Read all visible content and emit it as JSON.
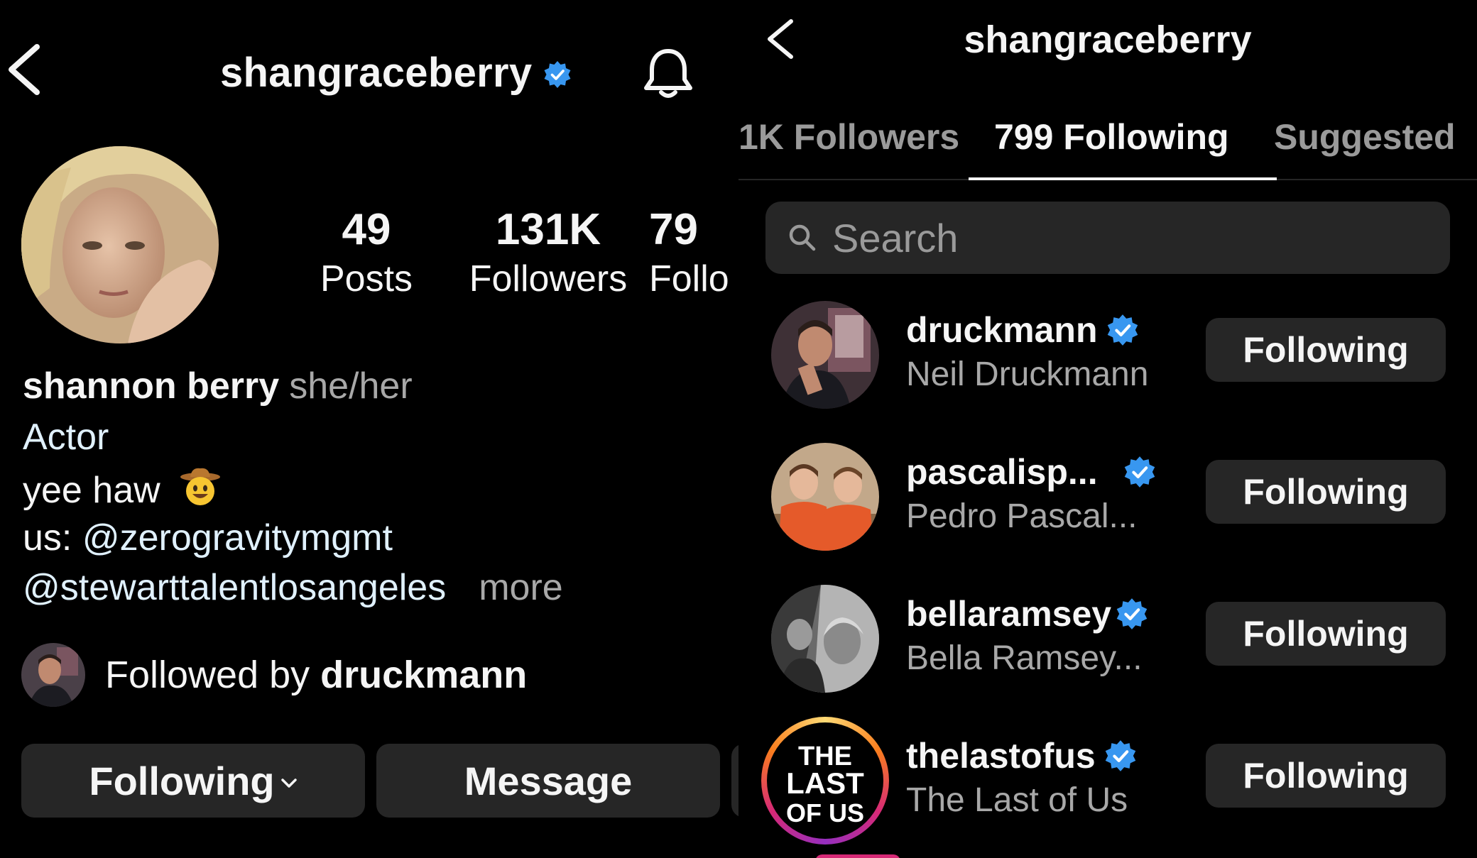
{
  "profile": {
    "username": "shangraceberry",
    "stats": {
      "posts": {
        "value": "49",
        "label": "Posts"
      },
      "followers": {
        "value": "131K",
        "label": "Followers"
      },
      "following": {
        "value": "79",
        "label": "Follo"
      }
    },
    "name": "shannon berry",
    "pronouns": "she/her",
    "category": "Actor",
    "bio_line": "yee haw",
    "bio_mgmt_prefix": "us: ",
    "bio_mgmt_handle": "@zerogravitymgmt",
    "bio_agency_handle": "@stewarttalentlosangeles",
    "bio_more": "more",
    "followed_by_prefix": "Followed by ",
    "followed_by_user": "druckmann",
    "buttons": {
      "following": "Following",
      "message": "Message"
    }
  },
  "following_page": {
    "title": "shangraceberry",
    "tabs": [
      {
        "label": "1K Followers"
      },
      {
        "label": "799 Following"
      },
      {
        "label": "Suggested"
      }
    ],
    "search": {
      "placeholder": "Search"
    },
    "rows": [
      {
        "username": "druckmann",
        "display_name": "Neil Druckmann",
        "button": "Following"
      },
      {
        "username": "pascalisp...",
        "display_name": "Pedro Pascal...",
        "button": "Following"
      },
      {
        "username": "bellaramsey",
        "display_name": "Bella Ramsey...",
        "button": "Following"
      },
      {
        "username": "thelastofus",
        "display_name": "The Last of Us",
        "button": "Following"
      }
    ],
    "logo_text": [
      "THE",
      "LAST",
      "OF US"
    ]
  },
  "colors": {
    "background": "#000000",
    "button": "#262626",
    "verified": "#3897f0",
    "muted_text": "#a8a8a8",
    "link_text": "#e0f1ff"
  },
  "icons": [
    "back-chevron-icon",
    "verified-badge-icon",
    "bell-icon",
    "search-icon",
    "chevron-down-icon",
    "cowboy-emoji-icon"
  ]
}
